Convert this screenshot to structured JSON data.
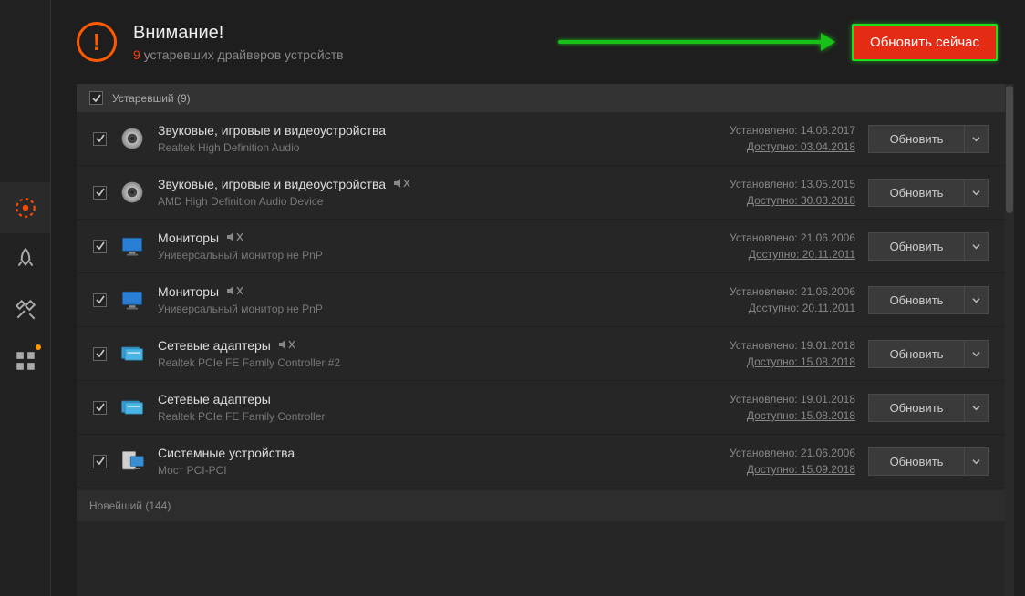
{
  "header": {
    "title": "Внимание!",
    "outdated_count": "9",
    "subtitle_text": "устаревших драйверов устройств",
    "update_all_label": "Обновить сейчас"
  },
  "sections": {
    "outdated_label": "Устаревший (9)",
    "newest_label": "Новейший (144)"
  },
  "labels": {
    "installed_prefix": "Установлено:",
    "available_prefix": "Доступно:",
    "update_button": "Обновить"
  },
  "drivers": [
    {
      "category": "Звуковые, игровые и видеоустройства",
      "name": "Realtek High Definition Audio",
      "installed": "14.06.2017",
      "available": "03.04.2018",
      "muted": false,
      "icon": "speaker"
    },
    {
      "category": "Звуковые, игровые и видеоустройства",
      "name": "AMD High Definition Audio Device",
      "installed": "13.05.2015",
      "available": "30.03.2018",
      "muted": true,
      "icon": "speaker"
    },
    {
      "category": "Мониторы",
      "name": "Универсальный монитор не PnP",
      "installed": "21.06.2006",
      "available": "20.11.2011",
      "muted": true,
      "icon": "monitor"
    },
    {
      "category": "Мониторы",
      "name": "Универсальный монитор не PnP",
      "installed": "21.06.2006",
      "available": "20.11.2011",
      "muted": true,
      "icon": "monitor"
    },
    {
      "category": "Сетевые адаптеры",
      "name": "Realtek PCIe FE Family Controller #2",
      "installed": "19.01.2018",
      "available": "15.08.2018",
      "muted": true,
      "icon": "network"
    },
    {
      "category": "Сетевые адаптеры",
      "name": "Realtek PCIe FE Family Controller",
      "installed": "19.01.2018",
      "available": "15.08.2018",
      "muted": false,
      "icon": "network"
    },
    {
      "category": "Системные устройства",
      "name": "Мост PCI-PCI",
      "installed": "21.06.2006",
      "available": "15.09.2018",
      "muted": false,
      "icon": "system"
    }
  ]
}
